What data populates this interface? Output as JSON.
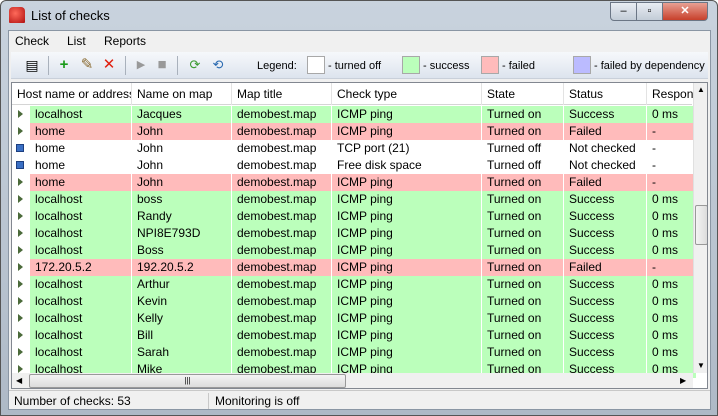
{
  "window": {
    "title": "List of checks"
  },
  "menu": [
    "Check",
    "List",
    "Reports"
  ],
  "legend": {
    "label": "Legend:",
    "items": [
      {
        "label": "- turned off",
        "color": "#ffffff"
      },
      {
        "label": "- success",
        "color": "#bbffbb"
      },
      {
        "label": "- failed",
        "color": "#ffbbbb"
      },
      {
        "label": "- failed by dependency",
        "color": "#bbbbff"
      }
    ]
  },
  "columns": [
    "Host name or address",
    "Name on map",
    "Map title",
    "Check type",
    "State",
    "Status",
    "Respons"
  ],
  "rows": [
    {
      "status": "success",
      "cells": [
        "localhost",
        "Jacques",
        "demobest.map",
        "ICMP ping",
        "Turned on",
        "Success",
        "0 ms"
      ]
    },
    {
      "status": "failed",
      "cells": [
        "home",
        "John",
        "demobest.map",
        "ICMP ping",
        "Turned on",
        "Failed",
        "-"
      ]
    },
    {
      "status": "off",
      "cells": [
        "home",
        "John",
        "demobest.map",
        "TCP port (21)",
        "Turned off",
        "Not checked",
        "-"
      ]
    },
    {
      "status": "off",
      "cells": [
        "home",
        "John",
        "demobest.map",
        "Free disk space",
        "Turned off",
        "Not checked",
        "-"
      ]
    },
    {
      "status": "failed",
      "cells": [
        "home",
        "John",
        "demobest.map",
        "ICMP ping",
        "Turned on",
        "Failed",
        "-"
      ]
    },
    {
      "status": "success",
      "cells": [
        "localhost",
        "boss",
        "demobest.map",
        "ICMP ping",
        "Turned on",
        "Success",
        "0 ms"
      ]
    },
    {
      "status": "success",
      "cells": [
        "localhost",
        "Randy",
        "demobest.map",
        "ICMP ping",
        "Turned on",
        "Success",
        "0 ms"
      ]
    },
    {
      "status": "success",
      "cells": [
        "localhost",
        "NPI8E793D",
        "demobest.map",
        "ICMP ping",
        "Turned on",
        "Success",
        "0 ms"
      ]
    },
    {
      "status": "success",
      "cells": [
        "localhost",
        "Boss",
        "demobest.map",
        "ICMP ping",
        "Turned on",
        "Success",
        "0 ms"
      ]
    },
    {
      "status": "failed",
      "cells": [
        "172.20.5.2",
        "192.20.5.2",
        "demobest.map",
        "ICMP ping",
        "Turned on",
        "Failed",
        "-"
      ]
    },
    {
      "status": "success",
      "cells": [
        "localhost",
        "Arthur",
        "demobest.map",
        "ICMP ping",
        "Turned on",
        "Success",
        "0 ms"
      ]
    },
    {
      "status": "success",
      "cells": [
        "localhost",
        "Kevin",
        "demobest.map",
        "ICMP ping",
        "Turned on",
        "Success",
        "0 ms"
      ]
    },
    {
      "status": "success",
      "cells": [
        "localhost",
        "Kelly",
        "demobest.map",
        "ICMP ping",
        "Turned on",
        "Success",
        "0 ms"
      ]
    },
    {
      "status": "success",
      "cells": [
        "localhost",
        "Bill",
        "demobest.map",
        "ICMP ping",
        "Turned on",
        "Success",
        "0 ms"
      ]
    },
    {
      "status": "success",
      "cells": [
        "localhost",
        "Sarah",
        "demobest.map",
        "ICMP ping",
        "Turned on",
        "Success",
        "0 ms"
      ]
    },
    {
      "status": "success",
      "cells": [
        "localhost",
        "Mike",
        "demobest.map",
        "ICMP ping",
        "Turned on",
        "Success",
        "0 ms"
      ]
    }
  ],
  "statusbar": {
    "count": "Number of checks: 53",
    "monitoring": "Monitoring is off"
  }
}
